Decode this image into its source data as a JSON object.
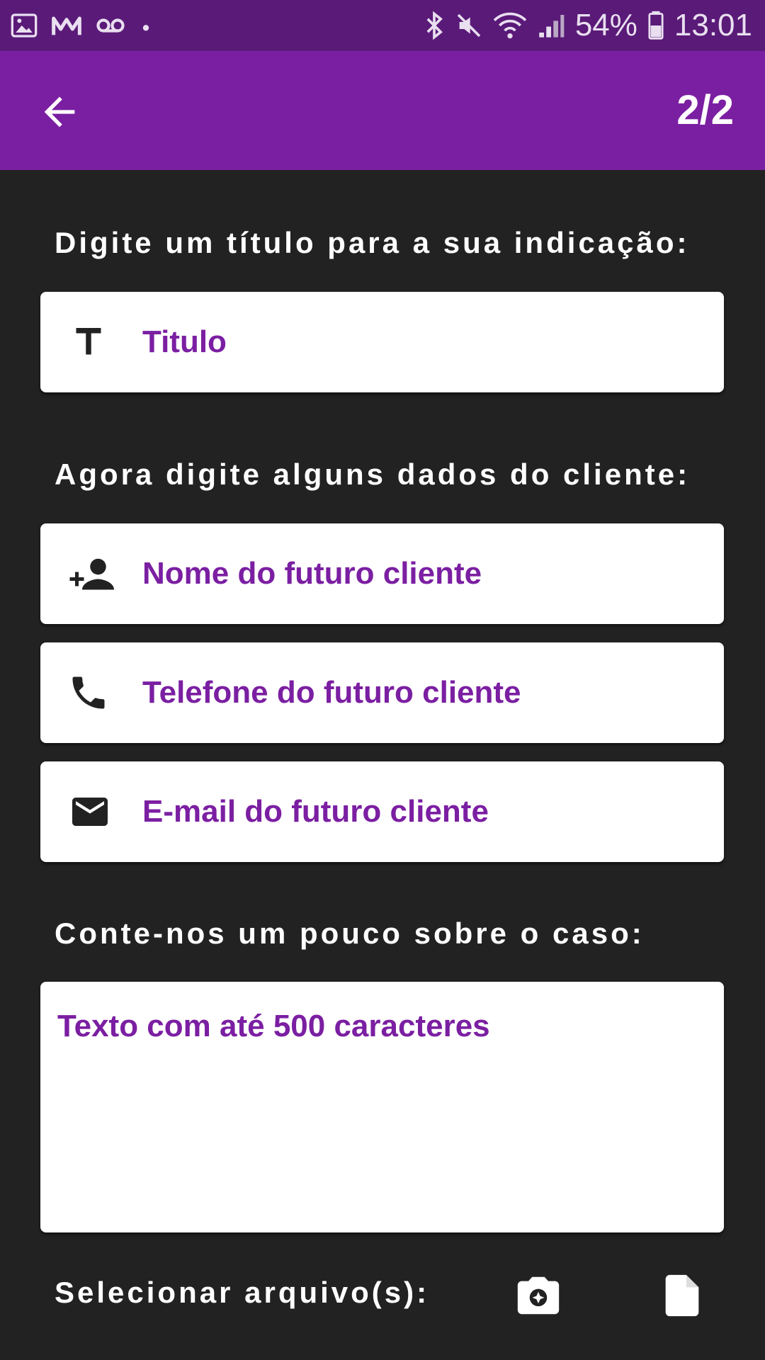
{
  "status_bar": {
    "battery": "54%",
    "time": "13:01",
    "left_icons": [
      "image-icon",
      "gmail-icon",
      "voicemail-icon",
      "dot-icon"
    ],
    "right_icons": [
      "bluetooth-icon",
      "mute-icon",
      "wifi-icon",
      "signal-icon",
      "battery-icon"
    ]
  },
  "app_bar": {
    "step": "2/2",
    "back_icon": "arrow-back-icon",
    "color": "#7b1fa2"
  },
  "sections": {
    "title_prompt": "Digite um título para a sua indicação:",
    "client_prompt": "Agora digite alguns dados do cliente:",
    "case_prompt": "Conte-nos um pouco sobre o caso:",
    "files_prompt": "Selecionar arquivo(s):"
  },
  "fields": {
    "title": {
      "placeholder": "Titulo",
      "icon": "text-format-icon"
    },
    "name": {
      "placeholder": "Nome do futuro cliente",
      "icon": "person-add-icon"
    },
    "phone": {
      "placeholder": "Telefone do futuro cliente",
      "icon": "phone-icon"
    },
    "email": {
      "placeholder": "E-mail do futuro cliente",
      "icon": "mail-icon"
    },
    "description": {
      "placeholder": "Texto com até 500 caracteres"
    }
  },
  "file_buttons": {
    "camera_icon": "camera-icon",
    "file_icon": "file-icon"
  },
  "colors": {
    "accent": "#7b1fa2",
    "status_bar": "#5a1a78",
    "background": "#222222"
  }
}
